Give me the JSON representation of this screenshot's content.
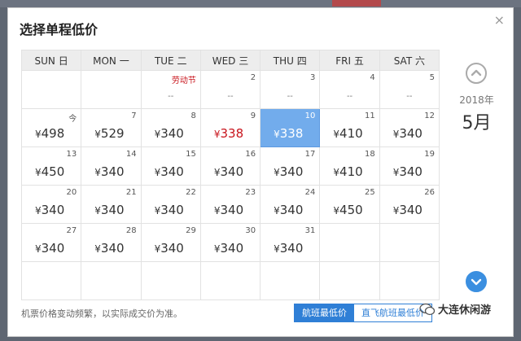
{
  "dialog": {
    "title": "选择单程低价",
    "close_glyph": "×"
  },
  "calendar": {
    "headers": [
      "SUN 日",
      "MON 一",
      "TUE 二",
      "WED 三",
      "THU 四",
      "FRI 五",
      "SAT 六"
    ],
    "weeks": [
      [
        {
          "empty": true
        },
        {
          "empty": true
        },
        {
          "holiday": "劳动节",
          "price": "--"
        },
        {
          "day": "2",
          "price": "--"
        },
        {
          "day": "3",
          "price": "--"
        },
        {
          "day": "4",
          "price": "--"
        },
        {
          "day": "5",
          "price": "--"
        }
      ],
      [
        {
          "day": "今",
          "price": "498"
        },
        {
          "day": "7",
          "price": "529"
        },
        {
          "day": "8",
          "price": "340"
        },
        {
          "day": "9",
          "price": "338",
          "low": true
        },
        {
          "day": "10",
          "price": "338",
          "selected": true
        },
        {
          "day": "11",
          "price": "410"
        },
        {
          "day": "12",
          "price": "340"
        }
      ],
      [
        {
          "day": "13",
          "price": "450"
        },
        {
          "day": "14",
          "price": "340"
        },
        {
          "day": "15",
          "price": "340"
        },
        {
          "day": "16",
          "price": "340"
        },
        {
          "day": "17",
          "price": "340"
        },
        {
          "day": "18",
          "price": "410"
        },
        {
          "day": "19",
          "price": "340"
        }
      ],
      [
        {
          "day": "20",
          "price": "340"
        },
        {
          "day": "21",
          "price": "340"
        },
        {
          "day": "22",
          "price": "340"
        },
        {
          "day": "23",
          "price": "340"
        },
        {
          "day": "24",
          "price": "340"
        },
        {
          "day": "25",
          "price": "450"
        },
        {
          "day": "26",
          "price": "340"
        }
      ],
      [
        {
          "day": "27",
          "price": "340"
        },
        {
          "day": "28",
          "price": "340"
        },
        {
          "day": "29",
          "price": "340"
        },
        {
          "day": "30",
          "price": "340"
        },
        {
          "day": "31",
          "price": "340"
        },
        {
          "empty": true
        },
        {
          "empty": true
        }
      ],
      [
        {
          "empty": true
        },
        {
          "empty": true
        },
        {
          "empty": true
        },
        {
          "empty": true
        },
        {
          "empty": true
        },
        {
          "empty": true
        },
        {
          "empty": true
        }
      ]
    ],
    "currency": "¥"
  },
  "side": {
    "year": "2018年",
    "month": "5月",
    "prev_icon": "chevron-up-icon",
    "next_icon": "chevron-down-icon"
  },
  "footer": {
    "note": "机票价格变动频繁，以实际成交价为准。",
    "tab_active": "航班最低价",
    "tab_inactive": "直飞航班最低价"
  },
  "watermark": {
    "text": "大连休闲游"
  },
  "colors": {
    "accent": "#2f7fd6",
    "selected": "#72acec",
    "low_price": "#c8141c"
  }
}
